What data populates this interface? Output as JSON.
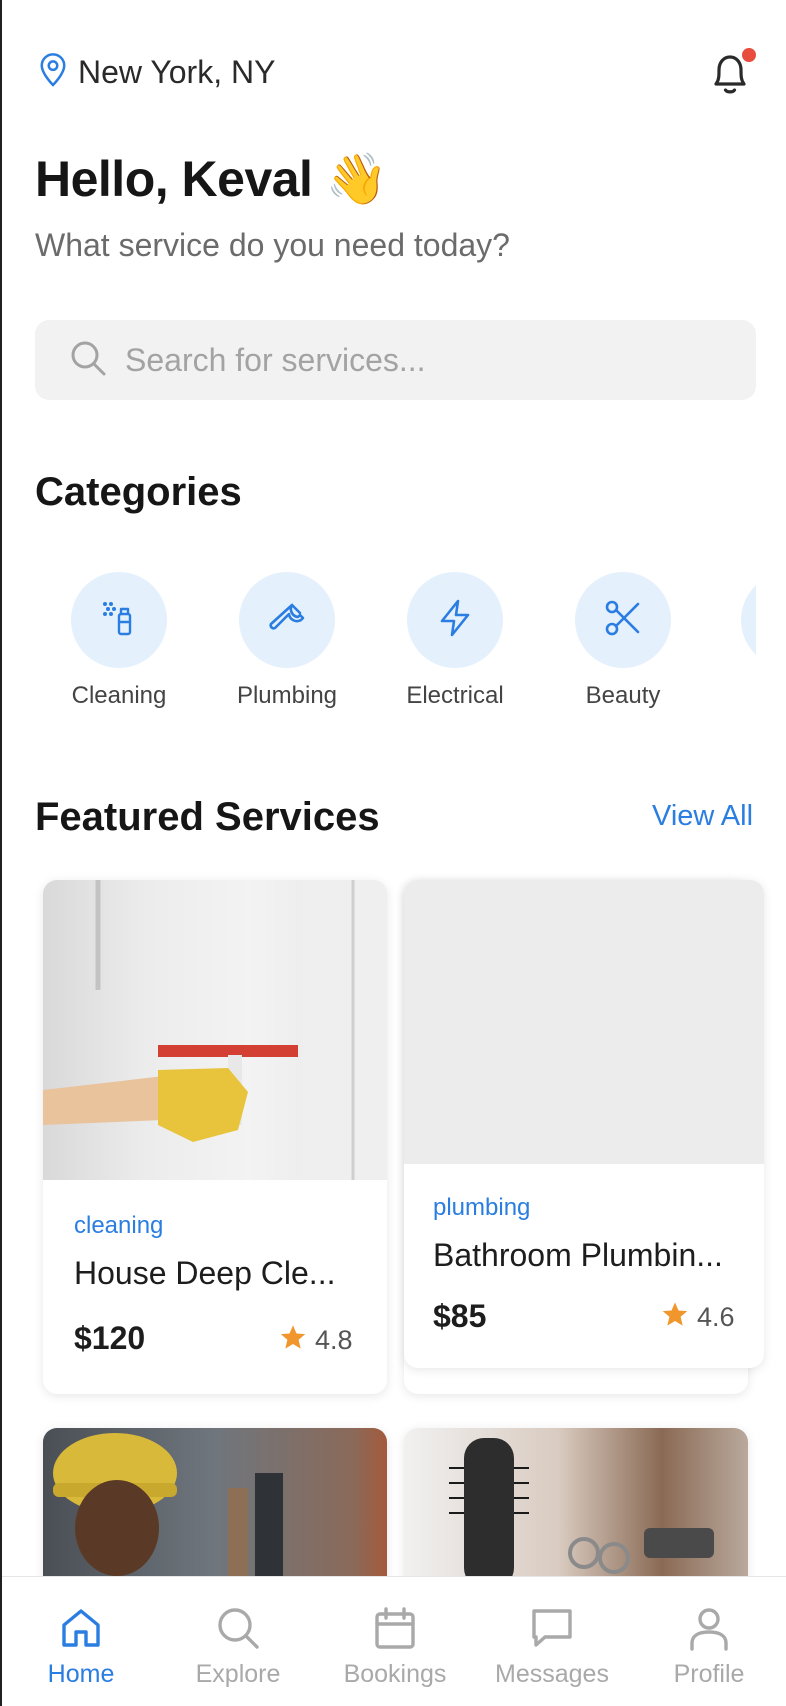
{
  "header": {
    "location": "New York, NY",
    "greeting": "Hello, Keval 👋",
    "subtitle": "What service do you need today?"
  },
  "search": {
    "placeholder": "Search for services..."
  },
  "categories": {
    "title": "Categories",
    "items": [
      {
        "label": "Cleaning",
        "icon": "spray-bottle-icon"
      },
      {
        "label": "Plumbing",
        "icon": "wrench-icon"
      },
      {
        "label": "Electrical",
        "icon": "lightning-icon"
      },
      {
        "label": "Beauty",
        "icon": "scissors-icon"
      }
    ]
  },
  "featured": {
    "title": "Featured Services",
    "view_all": "View All",
    "cards": [
      {
        "category": "cleaning",
        "title": "House Deep Cle...",
        "price": "$120",
        "rating": "4.8"
      },
      {
        "category": "plumbing",
        "title": "Bathroom Plumbin...",
        "price": "$85",
        "rating": "4.6"
      }
    ]
  },
  "nav": {
    "items": [
      {
        "label": "Home",
        "icon": "home-icon",
        "active": true
      },
      {
        "label": "Explore",
        "icon": "search-icon",
        "active": false
      },
      {
        "label": "Bookings",
        "icon": "calendar-icon",
        "active": false
      },
      {
        "label": "Messages",
        "icon": "chat-icon",
        "active": false
      },
      {
        "label": "Profile",
        "icon": "user-icon",
        "active": false
      }
    ]
  },
  "colors": {
    "accent": "#2a7de1",
    "category_bg": "#e5f0fd",
    "star": "#f0962c",
    "notification_dot": "#e74c3c"
  }
}
